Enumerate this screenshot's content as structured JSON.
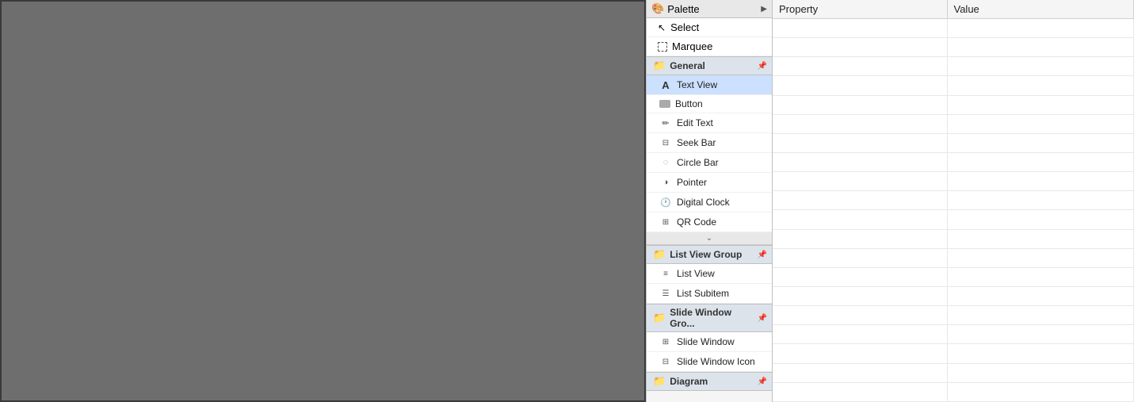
{
  "canvas": {
    "background": "#6e6e6e"
  },
  "palette": {
    "header_label": "Palette",
    "header_arrow": "▶",
    "tools": [
      {
        "id": "select",
        "label": "Select",
        "icon": "cursor"
      },
      {
        "id": "marquee",
        "label": "Marquee",
        "icon": "marquee"
      }
    ],
    "groups": [
      {
        "id": "general",
        "label": "General",
        "pin": "📌",
        "items": [
          {
            "id": "text-view",
            "label": "Text View",
            "icon": "A",
            "active": true
          },
          {
            "id": "button",
            "label": "Button",
            "icon": "btn"
          },
          {
            "id": "edit-text",
            "label": "Edit Text",
            "icon": "edit"
          },
          {
            "id": "seek-bar",
            "label": "Seek Bar",
            "icon": "seek"
          },
          {
            "id": "circle-bar",
            "label": "Circle Bar",
            "icon": "circle"
          },
          {
            "id": "pointer",
            "label": "Pointer",
            "icon": "ptr"
          },
          {
            "id": "digital-clock",
            "label": "Digital Clock",
            "icon": "clk"
          },
          {
            "id": "qr-code",
            "label": "QR Code",
            "icon": "qr"
          }
        ]
      },
      {
        "id": "list-view-group",
        "label": "List View Group",
        "pin": "📌",
        "items": [
          {
            "id": "list-view",
            "label": "List View",
            "icon": "lst"
          },
          {
            "id": "list-subitem",
            "label": "List Subitem",
            "icon": "sub"
          }
        ]
      },
      {
        "id": "slide-window-group",
        "label": "Slide Window Gro...",
        "pin": "📌",
        "items": [
          {
            "id": "slide-window",
            "label": "Slide Window",
            "icon": "sw"
          },
          {
            "id": "slide-window-icon",
            "label": "Slide Window Icon",
            "icon": "swi"
          }
        ]
      },
      {
        "id": "diagram",
        "label": "Diagram",
        "pin": "📌",
        "items": []
      }
    ]
  },
  "properties": {
    "col_property": "Property",
    "col_value": "Value",
    "rows": []
  }
}
